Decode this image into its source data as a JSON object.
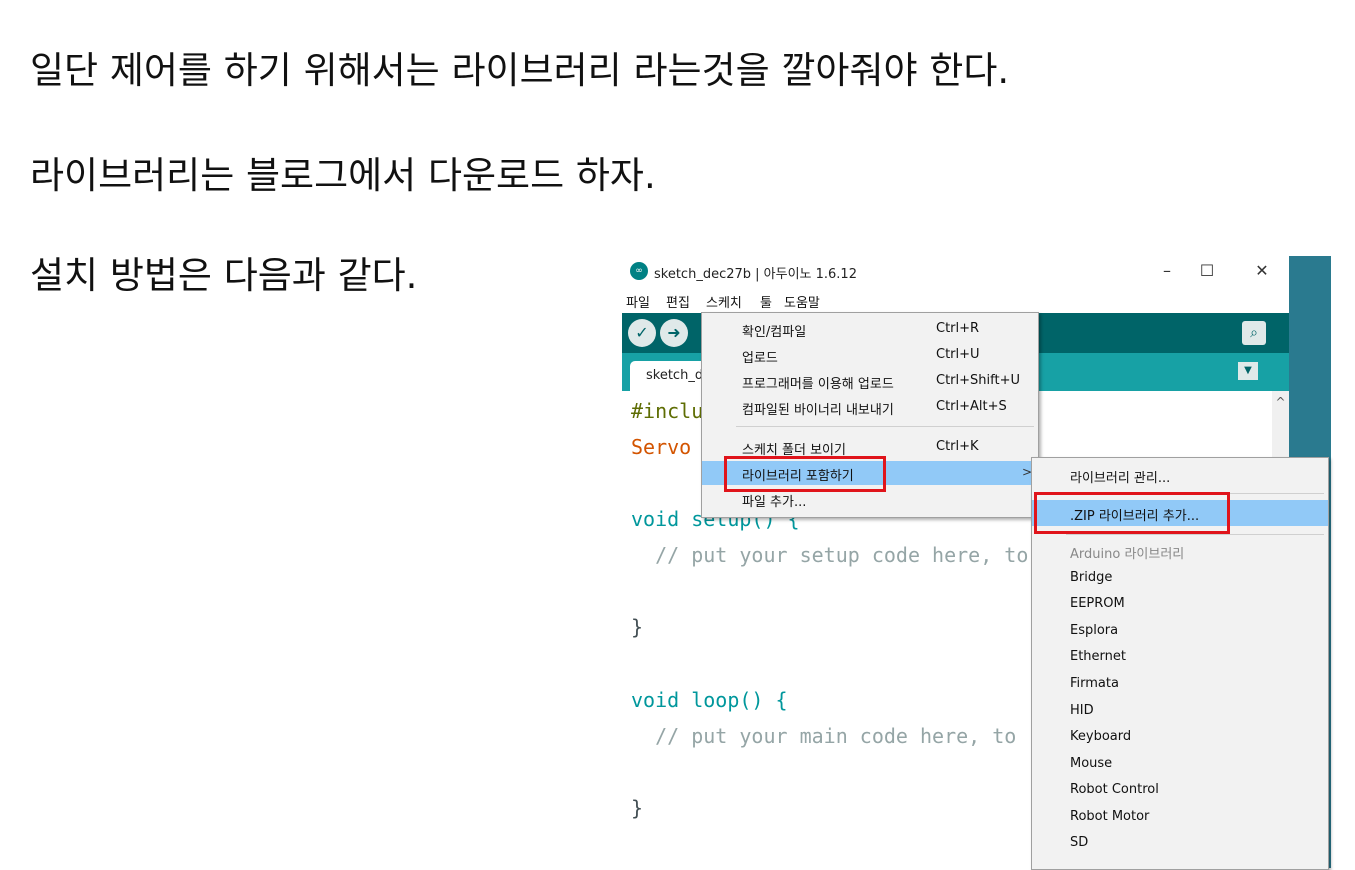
{
  "doc": {
    "line1": "일단 제어를 하기 위해서는 라이브러리 라는것을 깔아줘야 한다.",
    "line2": "라이브러리는 블로그에서 다운로드 하자.",
    "line3": "설치 방법은 다음과 같다."
  },
  "ide": {
    "logo": "∞",
    "title": "sketch_dec27b | 아두이노 1.6.12",
    "window_buttons": {
      "minimize": "–",
      "maximize": "☐",
      "close": "✕"
    },
    "menubar": [
      "파일",
      "편집",
      "스케치",
      "툴",
      "도움말"
    ],
    "toolbar": {
      "verify_icon": "✓",
      "upload_icon": "➜",
      "serial_icon": "⌕"
    },
    "tab_label": "sketch_dec27b",
    "tab_menu_icon": "▼",
    "scroll_up_icon": "^",
    "code": [
      "#include <Servo.h>",
      "Servo myservo;",
      "",
      "void setup() {",
      "  // put your setup code here, to run once:",
      "",
      "}",
      "",
      "void loop() {",
      "  // put your main code here, to run repeatedly:",
      "",
      "}"
    ]
  },
  "sketch_menu": {
    "items": [
      {
        "label": "확인/컴파일",
        "shortcut": "Ctrl+R"
      },
      {
        "label": "업로드",
        "shortcut": "Ctrl+U"
      },
      {
        "label": "프로그래머를 이용해 업로드",
        "shortcut": "Ctrl+Shift+U"
      },
      {
        "label": "컴파일된 바이너리 내보내기",
        "shortcut": "Ctrl+Alt+S"
      },
      {
        "label": "스케치 폴더 보이기",
        "shortcut": "Ctrl+K"
      },
      {
        "label": "라이브러리 포함하기",
        "shortcut": "",
        "arrow": ">"
      },
      {
        "label": "파일 추가...",
        "shortcut": ""
      }
    ]
  },
  "library_menu": {
    "items": [
      "라이브러리 관리...",
      ".ZIP 라이브러리 추가...",
      "Arduino 라이브러리",
      "Bridge",
      "EEPROM",
      "Esplora",
      "Ethernet",
      "Firmata",
      "HID",
      "Keyboard",
      "Mouse",
      "Robot Control",
      "Robot Motor",
      "SD"
    ]
  },
  "colors": {
    "toolbar": "#006468",
    "tabbar": "#17a1a5",
    "highlight_box": "#e0141b",
    "menu_selected": "#91c9f7"
  }
}
